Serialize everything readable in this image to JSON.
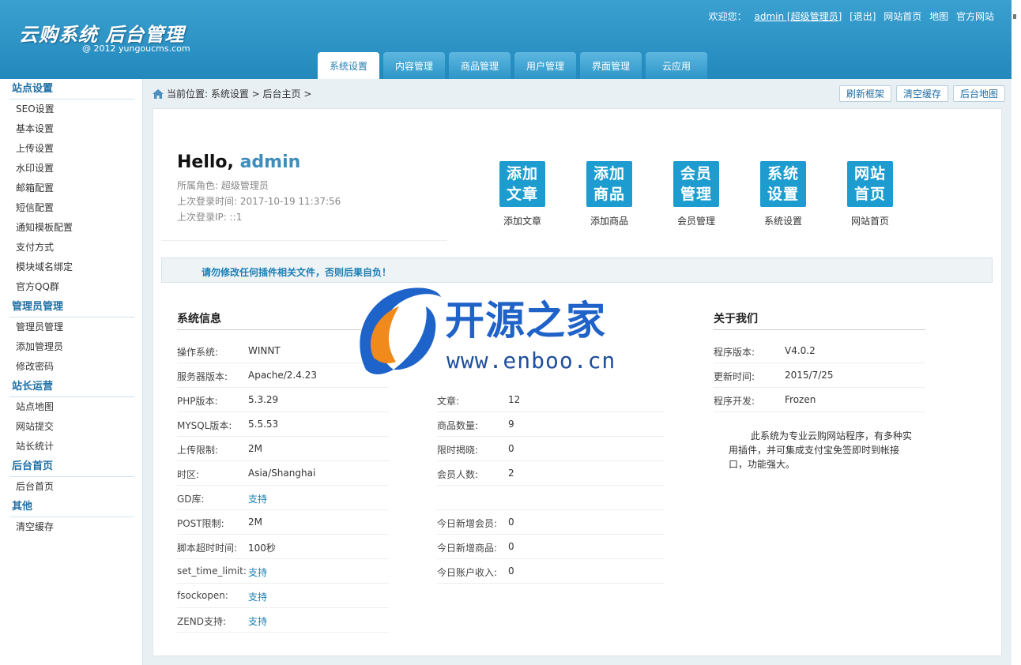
{
  "header": {
    "title": "云购系统 后台管理",
    "subtitle": "@ 2012 yungoucms.com",
    "welcome": "欢迎您：",
    "user": "admin [超级管理员]",
    "logout": "[退出]",
    "home": "网站首页",
    "map": "地图",
    "official": "官方网站"
  },
  "tabs": [
    "系统设置",
    "内容管理",
    "商品管理",
    "用户管理",
    "界面管理",
    "云应用"
  ],
  "sidebar": [
    {
      "head": "站点设置",
      "items": [
        "SEO设置",
        "基本设置",
        "上传设置",
        "水印设置",
        "邮箱配置",
        "短信配置",
        "通知模板配置",
        "支付方式",
        "模块域名绑定",
        "官方QQ群"
      ]
    },
    {
      "head": "管理员管理",
      "items": [
        "管理员管理",
        "添加管理员",
        "修改密码"
      ]
    },
    {
      "head": "站长运营",
      "items": [
        "站点地图",
        "网站提交",
        "站长统计"
      ]
    },
    {
      "head": "后台首页",
      "items": [
        "后台首页"
      ]
    },
    {
      "head": "其他",
      "items": [
        "清空缓存"
      ]
    }
  ],
  "breadcrumb": "当前位置: 系统设置 > 后台主页 >",
  "crumb_buttons": [
    "刷新框架",
    "清空缓存",
    "后台地图"
  ],
  "hello": {
    "greeting": "Hello,",
    "name": "admin",
    "role": "所属角色: 超级管理员",
    "last_time": "上次登录时间: 2017-10-19 11:37:56",
    "last_ip": "上次登录IP: ::1"
  },
  "quick": [
    {
      "icon": [
        "添加",
        "文章"
      ],
      "label": "添加文章"
    },
    {
      "icon": [
        "添加",
        "商品"
      ],
      "label": "添加商品"
    },
    {
      "icon": [
        "会员",
        "管理"
      ],
      "label": "会员管理"
    },
    {
      "icon": [
        "系统",
        "设置"
      ],
      "label": "系统设置"
    },
    {
      "icon": [
        "网站",
        "首页"
      ],
      "label": "网站首页"
    }
  ],
  "notice": "请勿修改任何插件相关文件，否则后果自负！",
  "sysinfo": {
    "title": "系统信息",
    "rows": [
      {
        "k": "操作系统:",
        "v": "WINNT"
      },
      {
        "k": "服务器版本:",
        "v": "Apache/2.4.23"
      },
      {
        "k": "PHP版本:",
        "v": "5.3.29"
      },
      {
        "k": "MYSQL版本:",
        "v": "5.5.53"
      },
      {
        "k": "上传限制:",
        "v": "2M"
      },
      {
        "k": "时区:",
        "v": "Asia/Shanghai"
      },
      {
        "k": "GD库:",
        "v": "支持"
      },
      {
        "k": "POST限制:",
        "v": "2M"
      },
      {
        "k": "脚本超时时间:",
        "v": "100秒"
      },
      {
        "k": "set_time_limit:",
        "v": "支持"
      },
      {
        "k": "fsockopen:",
        "v": "支持"
      },
      {
        "k": "ZEND支持:",
        "v": "支持"
      }
    ]
  },
  "stats": {
    "rows": [
      {
        "k": "文章:",
        "v": "12"
      },
      {
        "k": "商品数量:",
        "v": "9"
      },
      {
        "k": "限时揭晓:",
        "v": "0"
      },
      {
        "k": "会员人数:",
        "v": "2"
      },
      {
        "k": "",
        "v": ""
      },
      {
        "k": "今日新增会员:",
        "v": "0"
      },
      {
        "k": "今日新增商品:",
        "v": "0"
      },
      {
        "k": "今日账户收入:",
        "v": "0"
      }
    ]
  },
  "about": {
    "title": "关于我们",
    "rows": [
      {
        "k": "程序版本:",
        "v": "V4.0.2"
      },
      {
        "k": "更新时间:",
        "v": "2015/7/25"
      },
      {
        "k": "程序开发:",
        "v": "Frozen"
      }
    ],
    "text": "此系统为专业云购网站程序，有多种实用插件，并可集成支付宝免签即时到帐接口，功能强大。"
  },
  "watermark": {
    "brand": "开源之家",
    "url": "www.enboo.cn"
  }
}
